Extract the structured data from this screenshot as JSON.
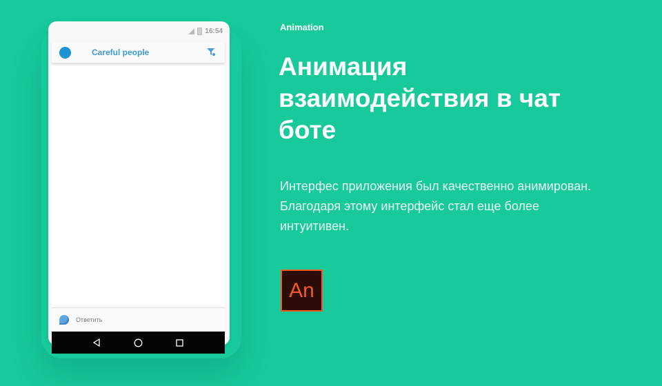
{
  "phone": {
    "status_time": "16:54",
    "app_title": "Careful people",
    "reply_label": "Ответить",
    "nav_icons": [
      "back-icon",
      "home-icon",
      "recents-icon"
    ],
    "colors": {
      "avatar": "#1c93d3",
      "title": "#3f9bd4",
      "nav_bar": "#050505"
    }
  },
  "info": {
    "eyebrow": "Animation",
    "headline": "Анимация взаимодействия в чат боте",
    "body": "Интерфес приложения был качественно анимирован. Благодаря этому интерфейс стал еще более интуитивен.",
    "badge_text": "An",
    "colors": {
      "background": "#17c99b",
      "badge_bg": "#2b0c06",
      "badge_accent": "#f5591f"
    }
  }
}
